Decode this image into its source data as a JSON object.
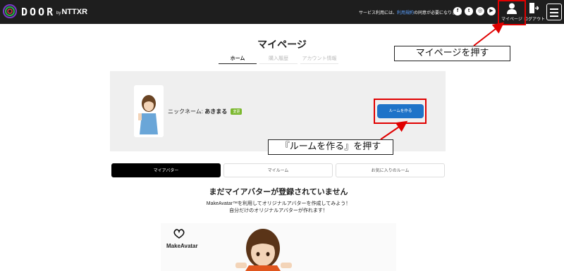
{
  "header": {
    "logo_text": "DOOR",
    "logo_by": "by",
    "logo_brand": "NTTXR",
    "notice_prefix": "サービス利用には、",
    "notice_link": "利用規約",
    "notice_suffix": "の同意が必要になります。",
    "social_icons": [
      "facebook-icon",
      "twitter-icon",
      "instagram-icon",
      "youtube-icon"
    ],
    "mypage_label": "マイページ",
    "logout_label": "ログアウト"
  },
  "page": {
    "title": "マイページ",
    "tabs": [
      {
        "label": "ホーム",
        "active": true
      },
      {
        "label": "購入履歴",
        "active": false
      },
      {
        "label": "アカウント情報",
        "active": false
      }
    ]
  },
  "profile": {
    "nickname_label": "ニックネーム:",
    "nickname": "あきまる",
    "edit_badge": "変更",
    "create_room_button": "ルームを作る"
  },
  "subtabs": [
    {
      "label": "マイアバター",
      "active": true
    },
    {
      "label": "マイルーム",
      "active": false
    },
    {
      "label": "お気に入りのルーム",
      "active": false
    }
  ],
  "empty_state": {
    "title": "まだマイアバターが登録されていません",
    "line1": "MakeAvatar™を利用してオリジナルアバターを作成してみよう！",
    "line2": "自分だけのオリジナルアバターが作れます！"
  },
  "banner": {
    "brand": "MakeAvatar"
  },
  "annotations": {
    "mypage_note": "マイページを押す",
    "room_note": "『ルームを作る』を押す",
    "highlight_color": "#e00000"
  },
  "colors": {
    "header_bg": "#1e1e1e",
    "accent_blue": "#1e73c8",
    "badge_green": "#7bb82e"
  }
}
